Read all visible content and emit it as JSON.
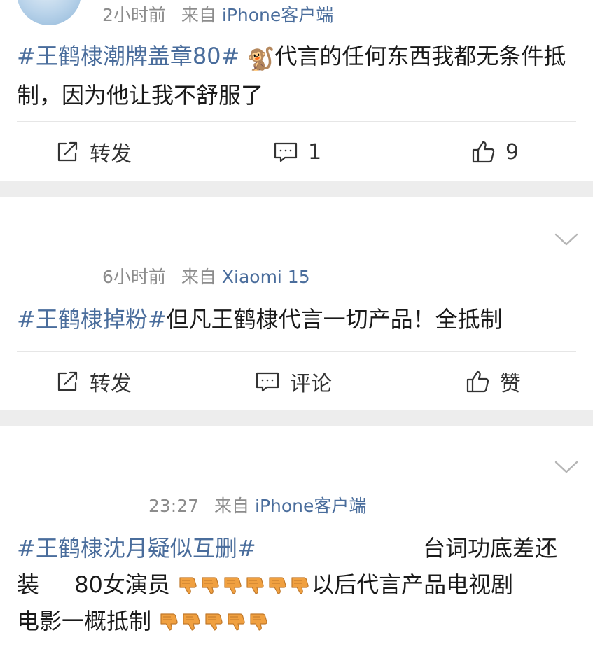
{
  "posts": [
    {
      "time": "2小时前",
      "from": "来自",
      "source": "iPhone客户端",
      "hashtag": "#王鹤棣潮牌盖章80#",
      "emoji": "🐒",
      "text": "代言的任何东西我都无条件抵制，因为他让我不舒服了",
      "actions": {
        "repost": "转发",
        "comment": "1",
        "like": "9"
      }
    },
    {
      "time": "6小时前",
      "from": "来自",
      "source": "Xiaomi 15",
      "hashtag": "#王鹤棣掉粉#",
      "text": "但凡王鹤棣代言一切产品！全抵制",
      "actions": {
        "repost": "转发",
        "comment": "评论",
        "like": "赞"
      }
    },
    {
      "time": "23:27",
      "from": "来自",
      "source": "iPhone客户端",
      "hashtag": "#王鹤棣沈月疑似互删#",
      "text_a": "台词功底差还装",
      "text_b": "80女演员",
      "thumbs_a": 6,
      "text_c": "以后代言产品电视剧电影一概抵制",
      "thumbs_b": 5
    }
  ],
  "icons": {
    "repost": "repost-icon",
    "comment": "comment-icon",
    "like": "thumbs-up-icon",
    "more": "chevron-down-icon",
    "dislike": "thumbs-down-emoji"
  },
  "colors": {
    "link": "#4a6d9c",
    "meta": "#8c8c8c",
    "separator": "#ededed",
    "thumb": "#f0a040"
  }
}
